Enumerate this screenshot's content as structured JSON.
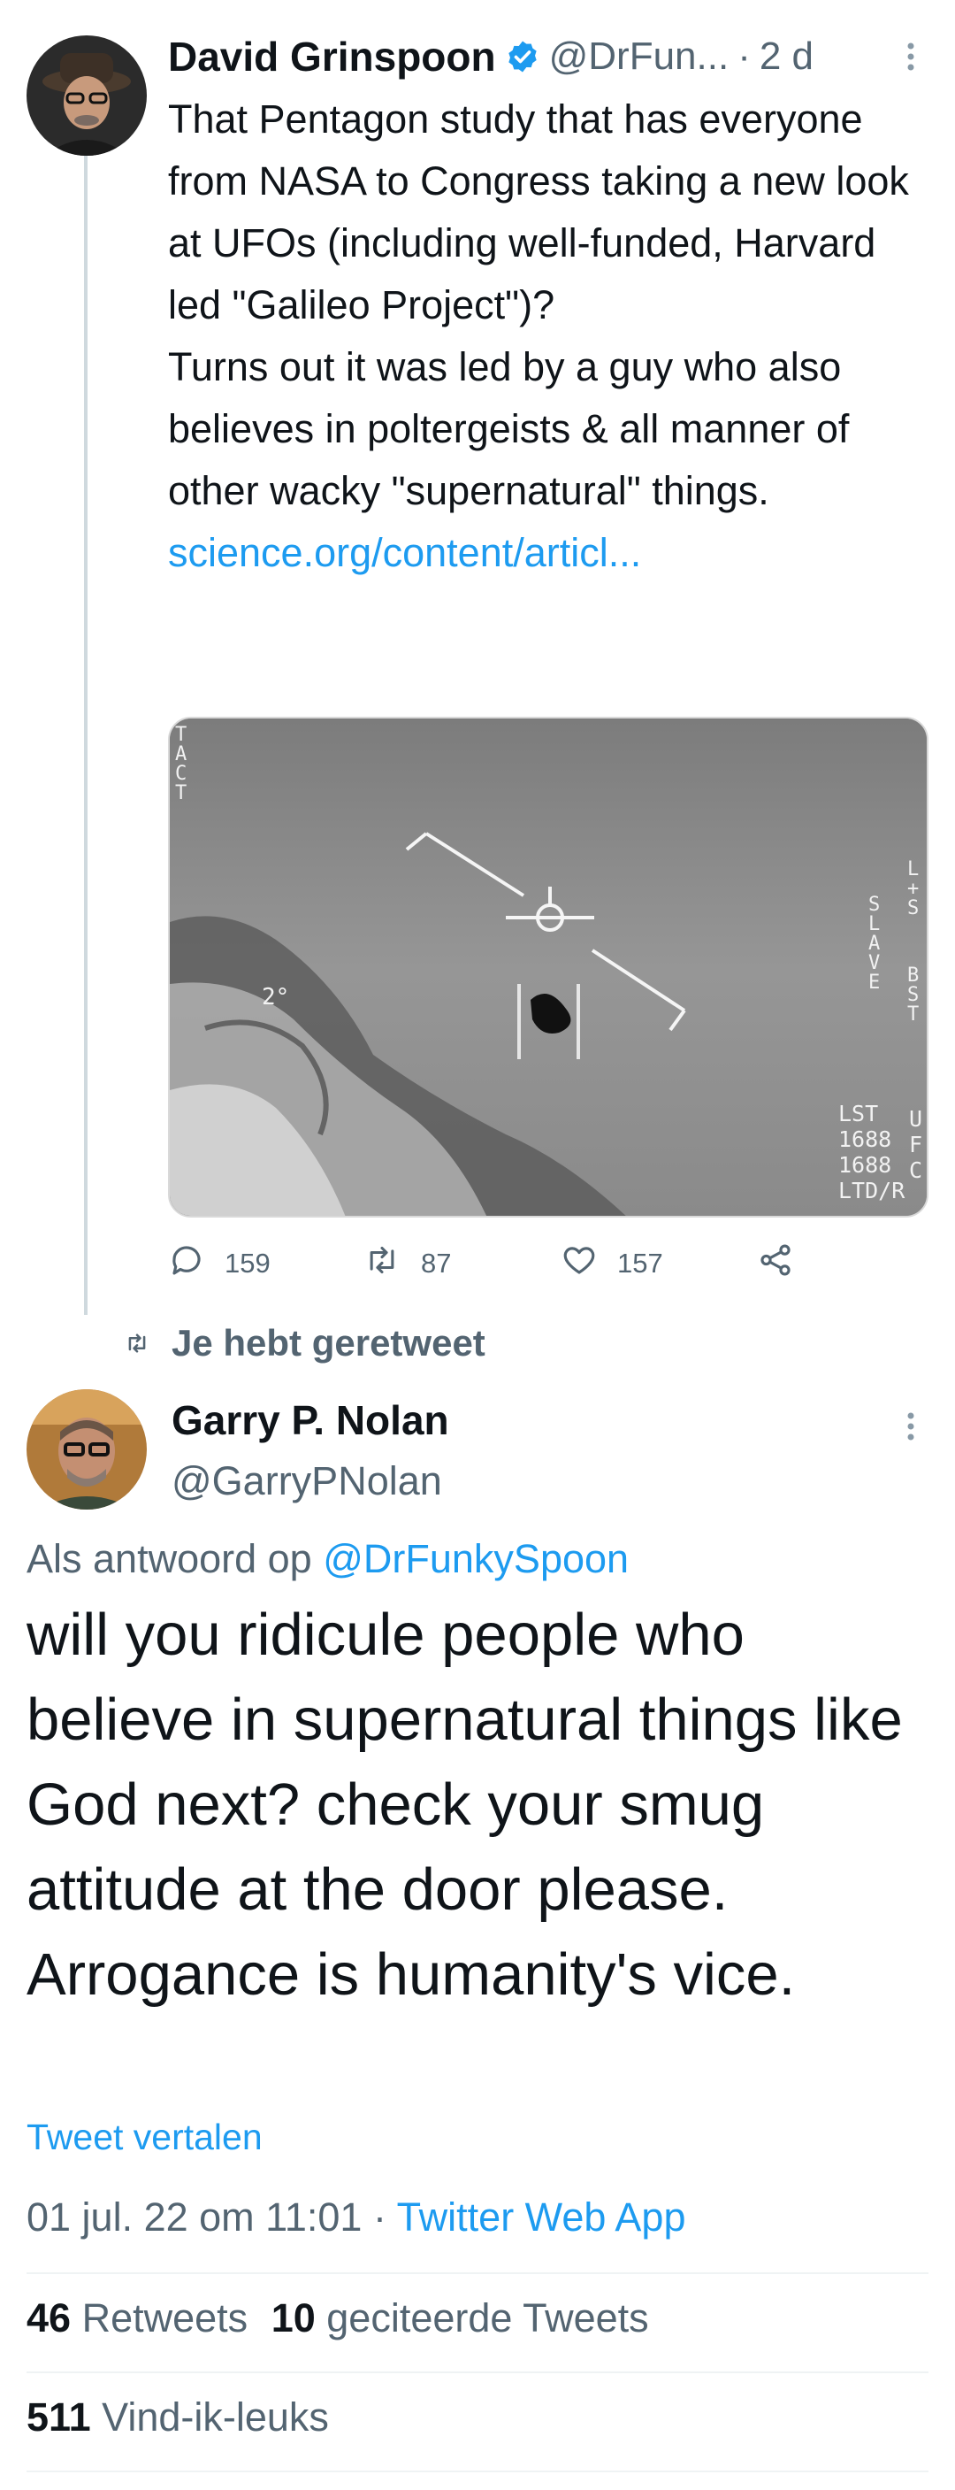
{
  "tweet1": {
    "author_name": "David Grinspoon",
    "handle": "@DrFun...",
    "separator": "·",
    "time": "2 d",
    "text_lines": [
      "That Pentagon study that has everyone from NASA to Congress taking a new look at UFOs (including well-funded, Harvard led \"Galileo Project\")?",
      "Turns out it was led by a guy who also believes in poltergeists & all manner of other wacky \"supernatural\" things."
    ],
    "link": "science.org/content/articl...",
    "media": {
      "overlay_top_left": "TACT",
      "overlay_left_mid": "2°",
      "overlay_right_vertical": "SLAVE",
      "overlay_right_edge": "L+S",
      "overlay_right_edge2": "BST",
      "overlay_bottom_right": [
        "LST",
        "1688",
        "1688",
        "LTD/R"
      ],
      "overlay_bottom_right_edge": [
        "U",
        "F",
        "C"
      ]
    },
    "actions": {
      "replies": "159",
      "retweets": "87",
      "likes": "157"
    }
  },
  "retweet_banner": "Je hebt geretweet",
  "tweet2": {
    "author_name": "Garry P. Nolan",
    "handle": "@GarryPNolan",
    "reply_prefix": "Als antwoord op",
    "reply_to": "@DrFunkySpoon",
    "text": "will you ridicule people who believe in supernatural things like God next?  check your smug attitude at the door please.  Arrogance is humanity's vice.",
    "translate": "Tweet vertalen",
    "timestamp": "01 jul. 22 om 11:01",
    "separator": "·",
    "source": "Twitter Web App",
    "stats": {
      "retweets_count": "46",
      "retweets_label": "Retweets",
      "quotes_count": "10",
      "quotes_label": "geciteerde Tweets",
      "likes_count": "511",
      "likes_label": "Vind-ik-leuks"
    }
  },
  "colors": {
    "link": "#1d9bf0",
    "muted": "#536471",
    "verified": "#1d9bf0",
    "text": "#0f1419"
  }
}
